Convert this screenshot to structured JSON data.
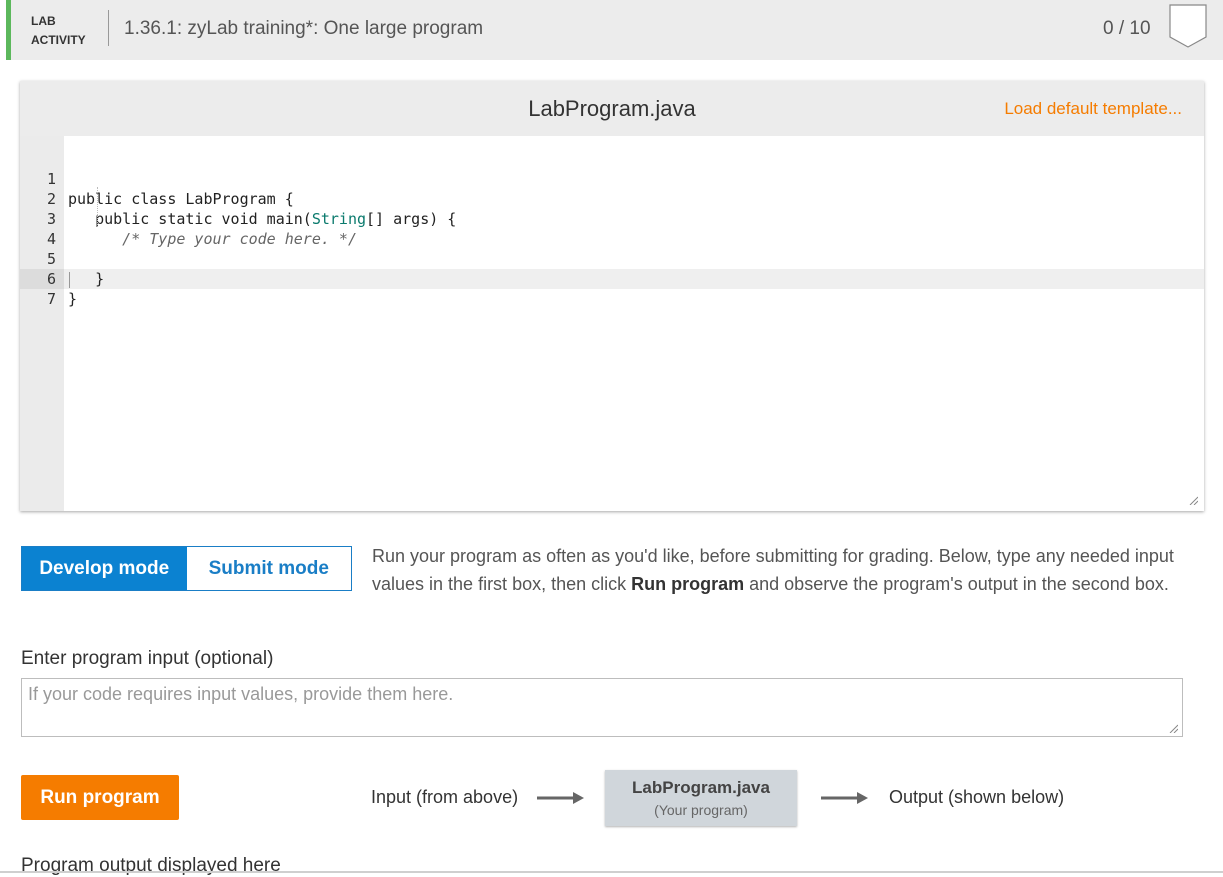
{
  "header": {
    "lab_label_line1": "LAB",
    "lab_label_line2": "ACTIVITY",
    "title": "1.36.1: zyLab training*: One large program",
    "score": "0 / 10",
    "accent_color": "#5cb85c"
  },
  "editor": {
    "file_name": "LabProgram.java",
    "load_template_label": "Load default template...",
    "lines": [
      {
        "num": "1",
        "text": "public class LabProgram {"
      },
      {
        "num": "2",
        "text": "   public static void main(String[] args) {"
      },
      {
        "num": "3",
        "text": "      /* Type your code here. */"
      },
      {
        "num": "4",
        "text": ""
      },
      {
        "num": "5",
        "text": "   }"
      },
      {
        "num": "6",
        "text": "}"
      },
      {
        "num": "7",
        "text": ""
      }
    ]
  },
  "modes": {
    "develop_label": "Develop mode",
    "submit_label": "Submit mode",
    "active": "develop",
    "description_part1": "Run your program as often as you'd like, before submitting for grading. Below, type any needed input values in the first box, then click ",
    "description_bold": "Run program",
    "description_part2": " and observe the program's output in the second box."
  },
  "input": {
    "label": "Enter program input (optional)",
    "placeholder": "If your code requires input values, provide them here.",
    "value": ""
  },
  "run": {
    "button_label": "Run program",
    "flow_input_label": "Input (from above)",
    "program_name": "LabProgram.java",
    "program_sub": "(Your program)",
    "flow_output_label": "Output (shown below)"
  },
  "output": {
    "label": "Program output displayed here"
  },
  "colors": {
    "primary_blue": "#0b82d1",
    "orange": "#f57c00"
  }
}
